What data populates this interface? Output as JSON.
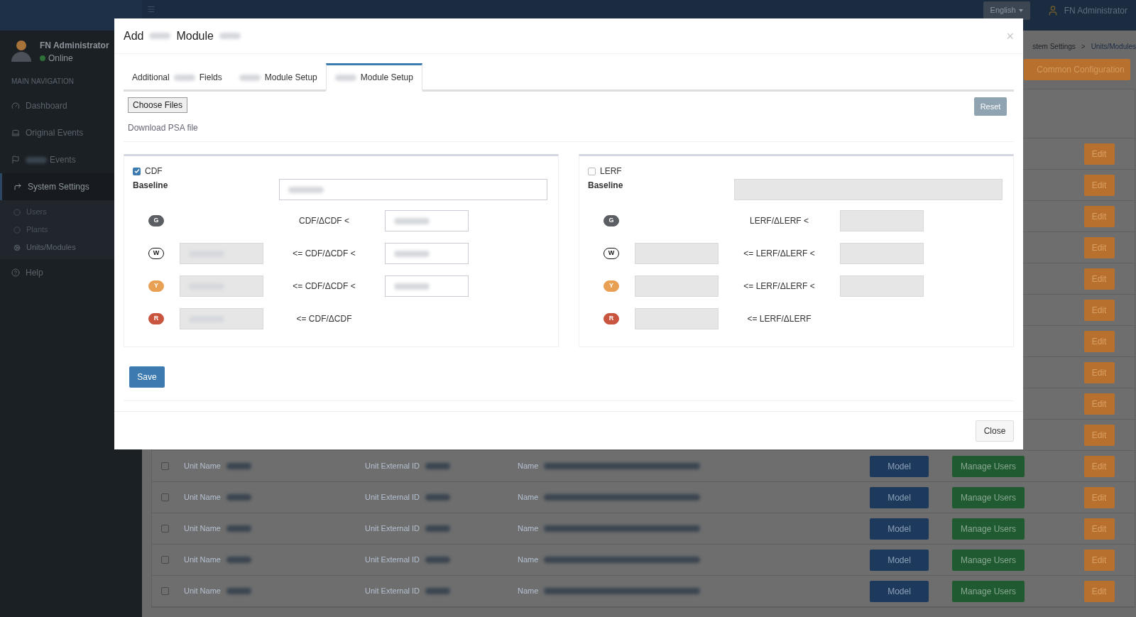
{
  "topbar": {
    "language": "English",
    "user": "FN Administrator"
  },
  "sidebar": {
    "user": {
      "name": "FN Administrator",
      "status": "Online"
    },
    "heading": "MAIN NAVIGATION",
    "items": [
      {
        "parts": [
          {
            "kind": "text",
            "text": "Dashboard"
          }
        ],
        "selected": false
      },
      {
        "parts": [
          {
            "kind": "text",
            "text": "Original Events"
          }
        ],
        "selected": false
      },
      {
        "parts": [
          {
            "kind": "redacted"
          },
          {
            "kind": "text",
            "text": "Events"
          }
        ],
        "selected": false
      },
      {
        "parts": [
          {
            "kind": "text",
            "text": "System Settings"
          }
        ],
        "selected": true,
        "children": [
          {
            "label": "Users",
            "selected": false
          },
          {
            "label": "Plants",
            "selected": false
          },
          {
            "label": "Units/Modules",
            "selected": true
          }
        ]
      },
      {
        "parts": [
          {
            "kind": "text",
            "text": "Help"
          }
        ],
        "selected": false
      }
    ]
  },
  "breadcrumb": {
    "items": [
      "stem Settings",
      "Units/Modules"
    ],
    "separator": ">"
  },
  "common_button": "Common Configuration",
  "table": {
    "rows": [
      {
        "kind": "partial",
        "edit": "Edit"
      },
      {
        "kind": "partial",
        "edit": "Edit"
      },
      {
        "kind": "partial",
        "edit": "Edit"
      },
      {
        "kind": "partial",
        "edit": "Edit"
      },
      {
        "kind": "partial",
        "edit": "Edit"
      },
      {
        "kind": "partial",
        "edit": "Edit"
      },
      {
        "kind": "partial",
        "edit": "Edit"
      },
      {
        "kind": "partial",
        "edit": "Edit"
      },
      {
        "kind": "partial",
        "edit": "Edit"
      },
      {
        "kind": "partial",
        "edit": "Edit"
      },
      {
        "kind": "full",
        "checked": false,
        "unit_name": "Unit Name",
        "external_id": "Unit External ID",
        "name": "Name",
        "model": "Model",
        "manage": "Manage Users",
        "edit": "Edit"
      },
      {
        "kind": "full",
        "checked": false,
        "unit_name": "Unit Name",
        "external_id": "Unit External ID",
        "name": "Name",
        "model": "Model",
        "manage": "Manage Users",
        "edit": "Edit"
      },
      {
        "kind": "full",
        "checked": false,
        "unit_name": "Unit Name",
        "external_id": "Unit External ID",
        "name": "Name",
        "model": "Model",
        "manage": "Manage Users",
        "edit": "Edit"
      },
      {
        "kind": "full",
        "checked": false,
        "unit_name": "Unit Name",
        "external_id": "Unit External ID",
        "name": "Name",
        "model": "Model",
        "manage": "Manage Users",
        "edit": "Edit"
      },
      {
        "kind": "full",
        "checked": false,
        "unit_name": "Unit Name",
        "external_id": "Unit External ID",
        "name": "Name",
        "model": "Model",
        "manage": "Manage Users",
        "edit": "Edit"
      }
    ]
  },
  "modal": {
    "title": [
      {
        "kind": "text",
        "text": "Add"
      },
      {
        "kind": "redacted"
      },
      {
        "kind": "text",
        "text": "Module"
      },
      {
        "kind": "redacted"
      }
    ],
    "close_icon": "×",
    "tabs": [
      {
        "parts": [
          {
            "kind": "text",
            "text": "Additional"
          },
          {
            "kind": "redacted"
          },
          {
            "kind": "text",
            "text": "Fields"
          }
        ],
        "selected": false
      },
      {
        "parts": [
          {
            "kind": "redacted"
          },
          {
            "kind": "text",
            "text": "Module Setup"
          }
        ],
        "selected": false
      },
      {
        "parts": [
          {
            "kind": "redacted"
          },
          {
            "kind": "text",
            "text": "Module Setup"
          }
        ],
        "selected": true
      }
    ],
    "file_button": "Choose Files",
    "reset_button": "Reset",
    "download_link": "Download PSA file",
    "panels": [
      {
        "label": "CDF",
        "checked": true,
        "baseline_label": "Baseline",
        "baseline": {
          "disabled": false,
          "redacted": true
        },
        "levels": [
          {
            "badge": "G",
            "color": "#5b5f63",
            "op": "CDF/ΔCDF <",
            "upper": {
              "disabled": false,
              "redacted": true
            }
          },
          {
            "badge": "W",
            "color": "#ffffff",
            "lower": {
              "disabled": true,
              "redacted": true
            },
            "op": "<= CDF/ΔCDF <",
            "upper": {
              "disabled": false,
              "redacted": true
            }
          },
          {
            "badge": "Y",
            "color": "#e8a055",
            "lower": {
              "disabled": true,
              "redacted": true
            },
            "op": "<= CDF/ΔCDF <",
            "upper": {
              "disabled": false,
              "redacted": true
            }
          },
          {
            "badge": "R",
            "color": "#c9553f",
            "lower": {
              "disabled": true,
              "redacted": true
            },
            "op": "<= CDF/ΔCDF"
          }
        ]
      },
      {
        "label": "LERF",
        "checked": false,
        "baseline_label": "Baseline",
        "baseline": {
          "disabled": true,
          "redacted": false
        },
        "levels": [
          {
            "badge": "G",
            "color": "#5b5f63",
            "op": "LERF/ΔLERF <",
            "upper": {
              "disabled": true,
              "redacted": false
            }
          },
          {
            "badge": "W",
            "color": "#ffffff",
            "lower": {
              "disabled": true,
              "redacted": false
            },
            "op": "<= LERF/ΔLERF <",
            "upper": {
              "disabled": true,
              "redacted": false
            }
          },
          {
            "badge": "Y",
            "color": "#e8a055",
            "lower": {
              "disabled": true,
              "redacted": false
            },
            "op": "<= LERF/ΔLERF <",
            "upper": {
              "disabled": true,
              "redacted": false
            }
          },
          {
            "badge": "R",
            "color": "#c9553f",
            "lower": {
              "disabled": true,
              "redacted": false
            },
            "op": "<= LERF/ΔLERF"
          }
        ]
      }
    ],
    "save_button": "Save",
    "close_button": "Close"
  }
}
